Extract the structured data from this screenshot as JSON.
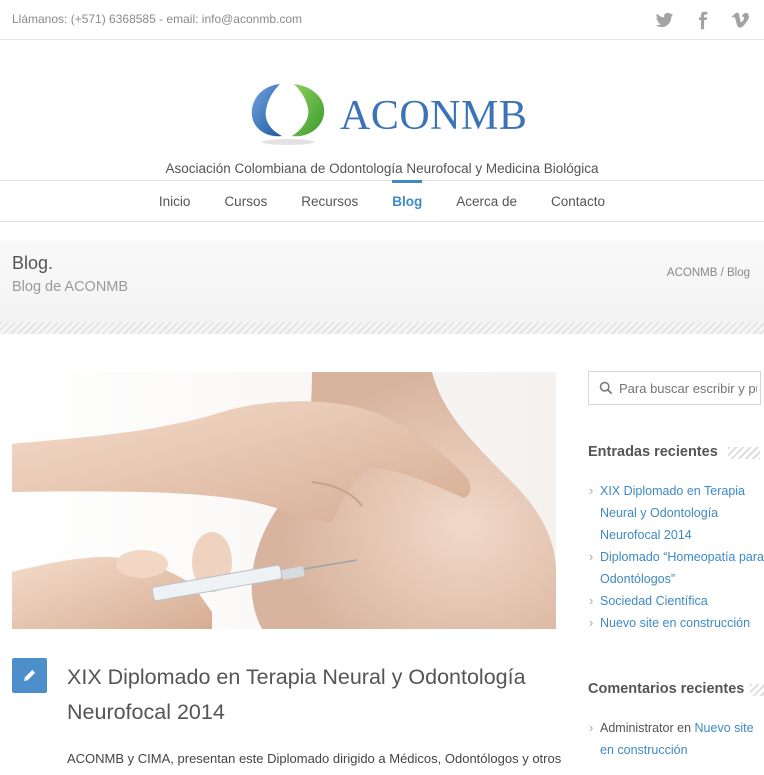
{
  "topbar": {
    "contact": "Llámanos: (+571) 6368585 - email: info@aconmb.com",
    "social": [
      "twitter-icon",
      "facebook-icon",
      "vimeo-icon"
    ]
  },
  "brand": {
    "name": "ACONMB",
    "tagline": "Asociación Colombiana de Odontología Neurofocal y Medicina Biológica",
    "colors": {
      "blue": "#3c73b6",
      "green": "#58b13c",
      "accent": "#3d8ac6"
    }
  },
  "nav": {
    "items": [
      "Inicio",
      "Cursos",
      "Recursos",
      "Blog",
      "Acerca de",
      "Contacto"
    ],
    "active": "Blog"
  },
  "page": {
    "title": "Blog.",
    "subtitle": "Blog de ACONMB",
    "breadcrumb": "ACONMB / Blog"
  },
  "post": {
    "title": "XIX Diplomado en Terapia Neural y Odontología Neurofocal 2014",
    "excerpt": "ACONMB y CIMA, presentan este Diplomado dirigido a Médicos, Odontólogos y otros",
    "icon": "pencil-icon"
  },
  "sidebar": {
    "search_placeholder": "Para buscar escribir y pulse enter",
    "recent_title": "Entradas recientes",
    "recent": [
      "XIX Diplomado en Terapia Neural y Odontología Neurofocal 2014",
      "Diplomado “Homeopatía para Odontólogos”",
      "Sociedad Científica",
      "Nuevo site en construcción"
    ],
    "comments_title": "Comentarios recientes",
    "comments": [
      {
        "author": "Administrator",
        "joiner": "en",
        "post": "Nuevo site en construcción"
      }
    ]
  }
}
